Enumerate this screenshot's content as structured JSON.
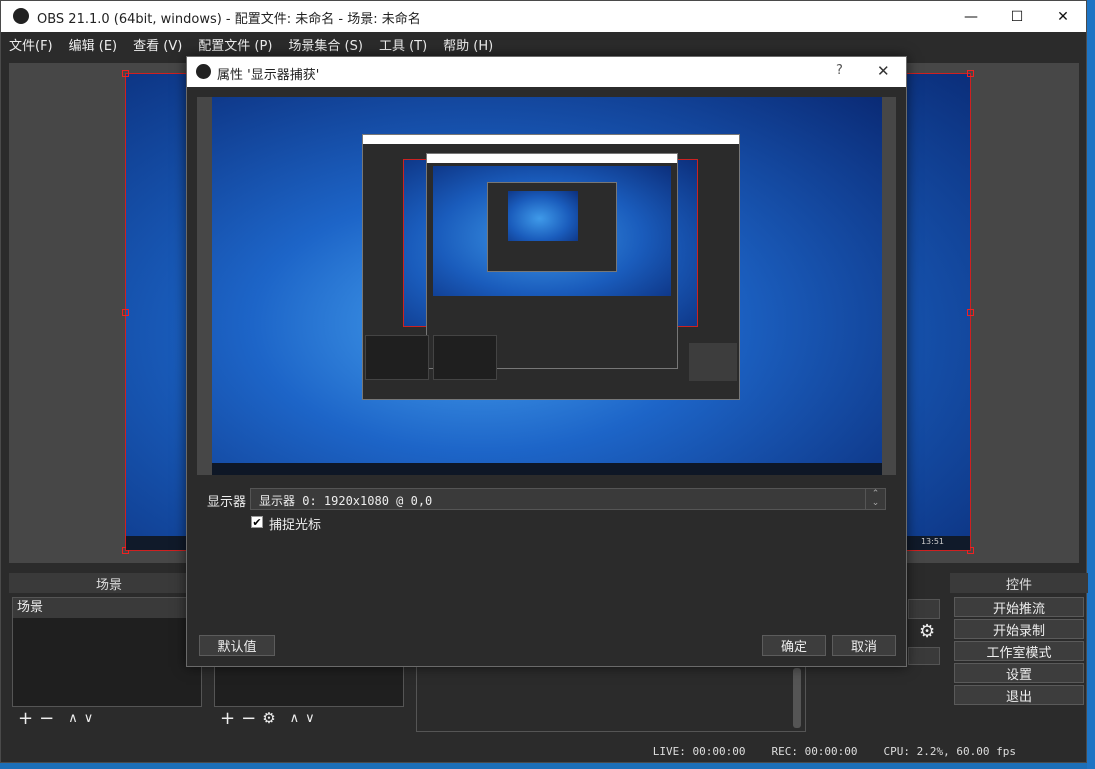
{
  "window": {
    "title": "OBS 21.1.0 (64bit, windows) - 配置文件: 未命名 - 场景: 未命名",
    "minimize": "—",
    "maximize": "☐",
    "close": "✕"
  },
  "menu": [
    "文件(F)",
    "编辑 (E)",
    "查看 (V)",
    "配置文件 (P)",
    "场景集合 (S)",
    "工具 (T)",
    "帮助 (H)"
  ],
  "docks": {
    "scenes_title": "场景",
    "scene_item": "场景",
    "controls_title": "控件"
  },
  "controls": [
    "开始推流",
    "开始录制",
    "工作室模式",
    "设置",
    "退出"
  ],
  "status": {
    "live": "LIVE: 00:00:00",
    "rec": "REC: 00:00:00",
    "cpu": "CPU: 2.2%, 60.00 fps"
  },
  "dialog": {
    "title": "属性 '显示器捕获'",
    "help": "?",
    "close": "✕",
    "monitor_label": "显示器",
    "monitor_value": "显示器 0: 1920x1080 @ 0,0",
    "capture_cursor_label": "捕捉光标",
    "capture_cursor_checked": true,
    "defaults_button": "默认值",
    "ok_button": "确定",
    "cancel_button": "取消"
  },
  "preview_taskbar_time": "13:51",
  "colors": {
    "accent_border": "#d02020",
    "desktop_blue": "#1a5fbf",
    "panel_bg": "#2b2b2b"
  }
}
